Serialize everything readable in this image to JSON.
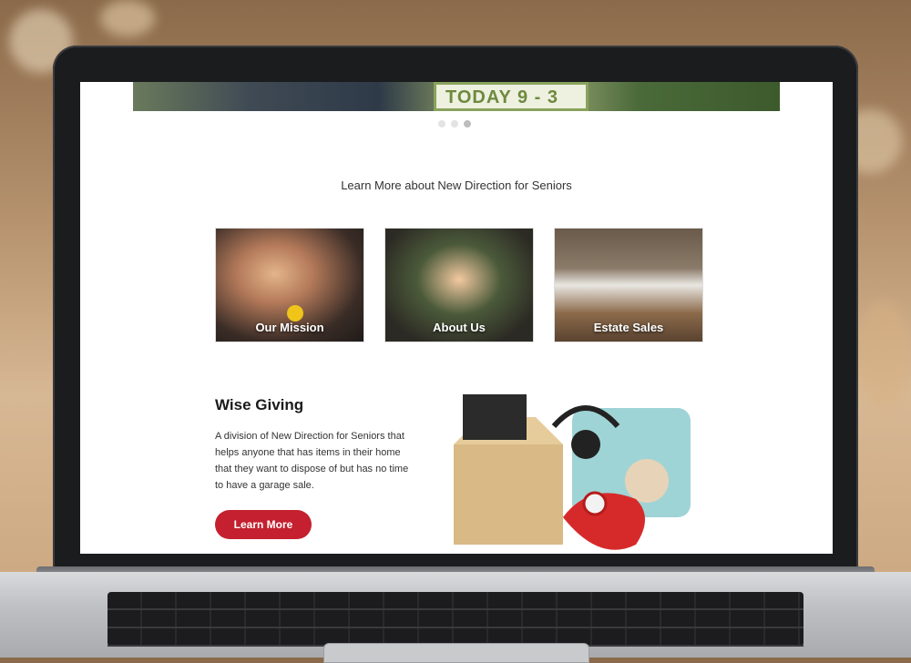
{
  "hero": {
    "sign_text": "TODAY 9 - 3"
  },
  "carousel": {
    "dots": 3,
    "active_index": 2
  },
  "section": {
    "title": "Learn More about New Direction for Seniors"
  },
  "cards": [
    {
      "label": "Our Mission"
    },
    {
      "label": "About Us"
    },
    {
      "label": "Estate Sales"
    }
  ],
  "wise_giving": {
    "title": "Wise Giving",
    "description": "A division of New Direction for Seniors that helps anyone that has items in their home that they want to dispose of but has no time to have a garage sale.",
    "button_label": "Learn More"
  },
  "colors": {
    "accent": "#c4202f",
    "sign_green": "#8aa35c"
  }
}
